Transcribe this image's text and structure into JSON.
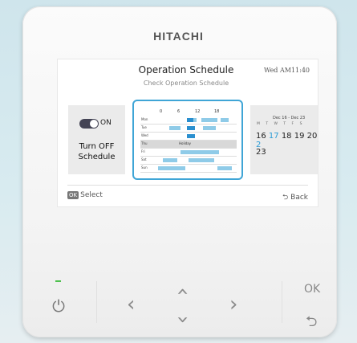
{
  "brand": "HITACHI",
  "screen": {
    "title": "Operation Schedule",
    "subtitle": "Check Operation Schedule",
    "time": "Wed AM11:40",
    "left_card": {
      "toggle_label": "ON",
      "line1": "Turn OFF",
      "line2": "Schedule"
    },
    "center_card": {
      "hours": [
        "0",
        "6",
        "12",
        "18"
      ],
      "days": [
        "Mon",
        "Tue",
        "Wed",
        "Thu",
        "Fri",
        "Sat",
        "Sun"
      ],
      "holiday_label": "Holiday"
    },
    "right_card": {
      "range": "Dec 16 - Dec 23",
      "weekdays": "M T W T F S",
      "dates": "16 17 18 19 20 2",
      "dates_parts": {
        "a": "16 ",
        "b": "17",
        "c": " 18 19 20 ",
        "d": "2"
      },
      "next": "23"
    },
    "footer": {
      "ok_badge": "OK",
      "ok_label": "Select",
      "back_label": "Back"
    }
  },
  "buttons": {
    "power": "power-icon",
    "ok_label": "OK",
    "back": "back-icon",
    "left": "chevron-left-icon",
    "right": "chevron-right-icon",
    "up": "chevron-up-icon",
    "down": "chevron-down-icon"
  },
  "colors": {
    "accent": "#3fa5d6",
    "led": "#4fc14f"
  }
}
